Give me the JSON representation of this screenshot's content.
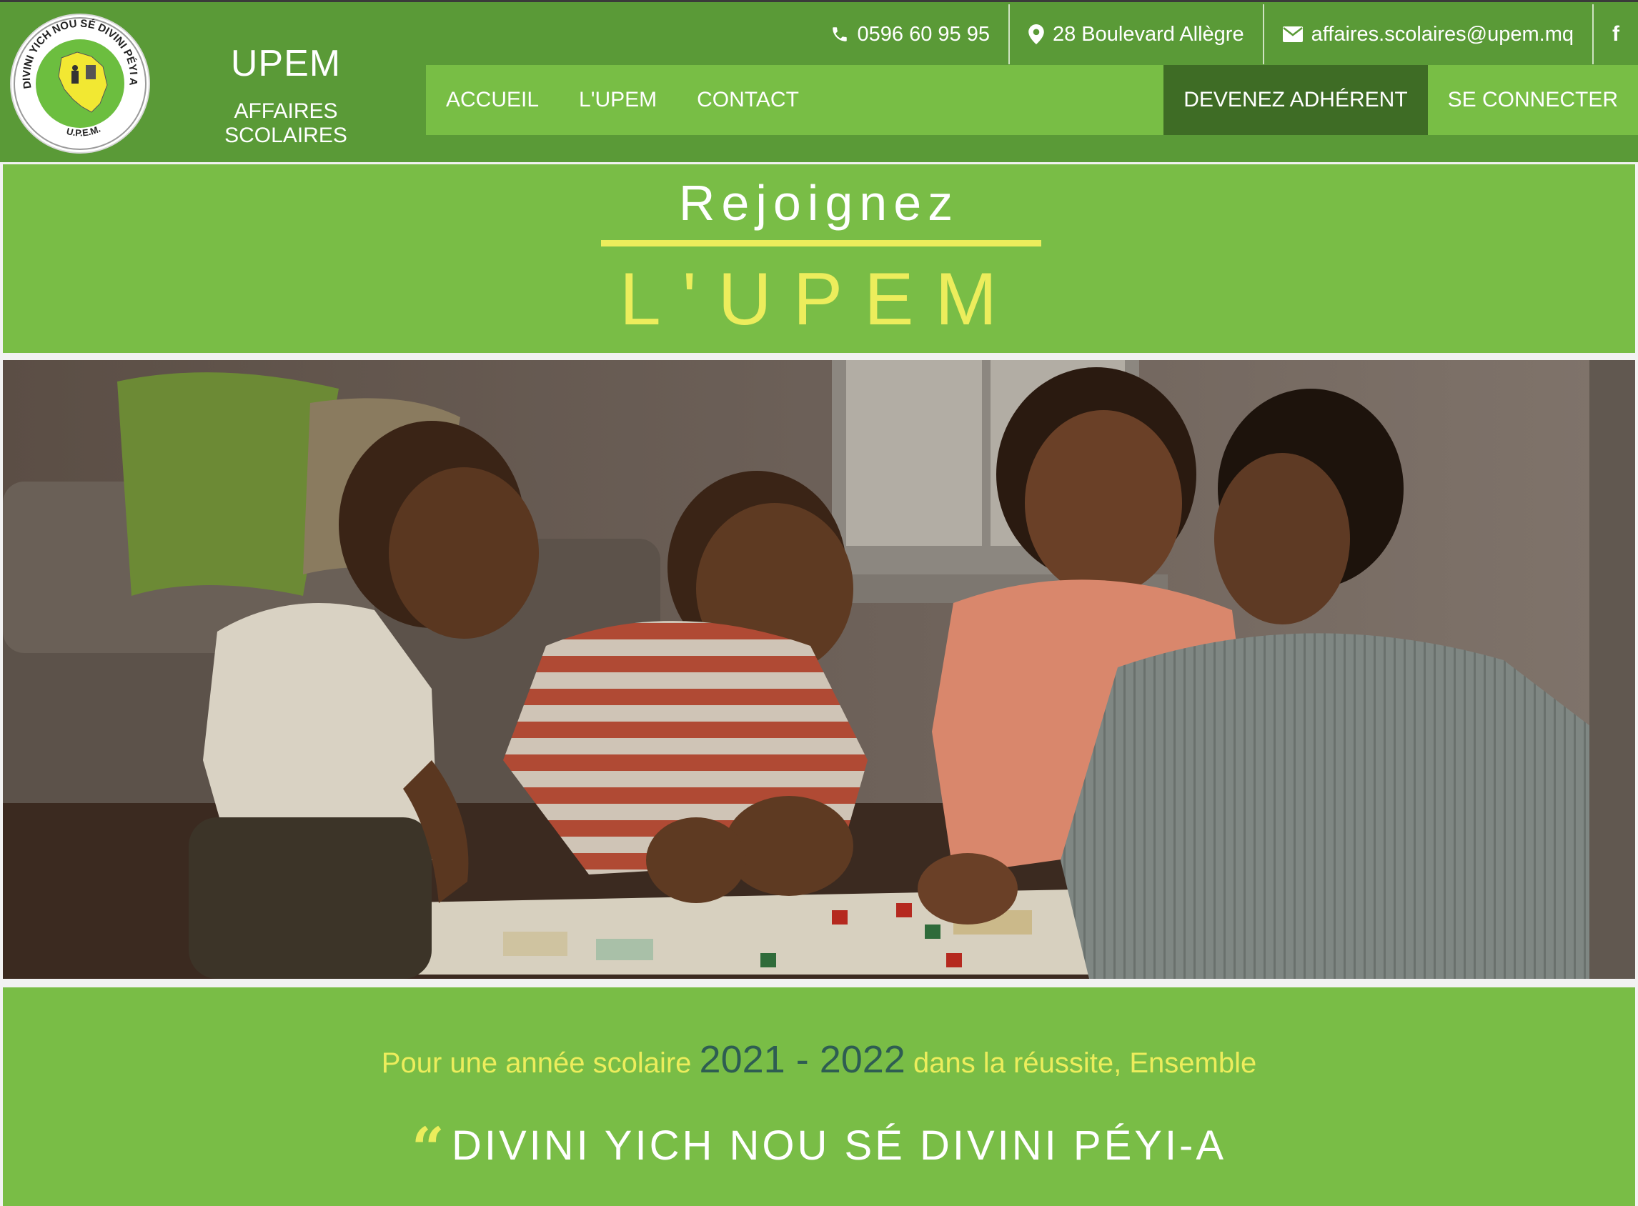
{
  "brand": {
    "title": "UPEM",
    "subtitle": "AFFAIRES SCOLAIRES",
    "logo_text": "DIVINI YICH NOU SÉ DIVINI PÉYI A",
    "logo_initials": "U.P.E.M."
  },
  "contact_bar": {
    "phone": "0596 60 95 95",
    "address": "28 Boulevard Allègre",
    "email": "affaires.scolaires@upem.mq",
    "facebook": "f"
  },
  "nav": {
    "links": [
      "ACCUEIL",
      "L'UPEM",
      "CONTACT"
    ],
    "join_label": "DEVENEZ ADHÉRENT",
    "login_label": "SE CONNECTER"
  },
  "hero": {
    "line1": "Rejoignez",
    "line2": "L'UPEM"
  },
  "footer_band": {
    "tagline_before": "Pour une année scolaire",
    "year_start": "2021",
    "year_sep": " - ",
    "year_end": "2022",
    "tagline_after": "dans la réussite, Ensemble",
    "quote_mark": "“",
    "quote": "DIVINI YICH NOU SÉ DIVINI PÉYI-A"
  },
  "colors": {
    "header_green": "#5a9a37",
    "nav_green": "#78be45",
    "join_dark": "#3e6c25",
    "accent_yellow": "#eced5c",
    "year_teal": "#2e5d52"
  },
  "icons": {
    "phone": "phone-icon",
    "address": "map-marker-icon",
    "email": "envelope-icon",
    "facebook": "facebook-icon"
  }
}
